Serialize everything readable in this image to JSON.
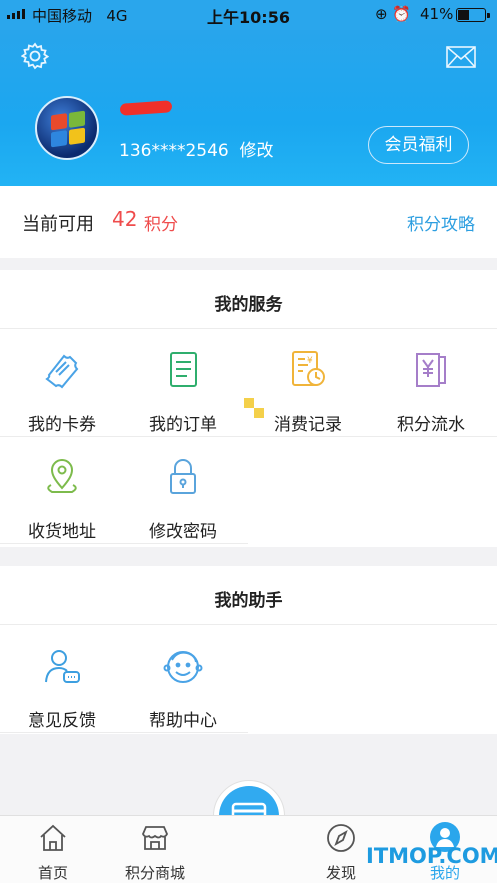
{
  "status_bar": {
    "carrier": "中国移动",
    "network": "4G",
    "time": "上午10:56",
    "battery_percent": "41%",
    "battery_level": 0.41
  },
  "header": {
    "settings_icon": "gear-icon",
    "message_icon": "envelope-icon",
    "avatar_icon": "windows-logo",
    "phone": "136****2546",
    "edit_label": "修改",
    "vip_button": "会员福利"
  },
  "points": {
    "label": "当前可用",
    "value": "42",
    "unit": "积分",
    "strategy_link": "积分攻略"
  },
  "services": {
    "title": "我的服务",
    "items": [
      {
        "label": "我的卡券",
        "icon": "ticket-icon"
      },
      {
        "label": "我的订单",
        "icon": "order-list-icon"
      },
      {
        "label": "消费记录",
        "icon": "receipt-clock-icon"
      },
      {
        "label": "积分流水",
        "icon": "yen-document-icon"
      },
      {
        "label": "收货地址",
        "icon": "location-pin-icon"
      },
      {
        "label": "修改密码",
        "icon": "padlock-icon"
      }
    ]
  },
  "helper": {
    "title": "我的助手",
    "items": [
      {
        "label": "意见反馈",
        "icon": "feedback-person-icon"
      },
      {
        "label": "帮助中心",
        "icon": "smiley-face-icon"
      }
    ]
  },
  "tabbar": {
    "items": [
      {
        "label": "首页",
        "icon": "home-icon"
      },
      {
        "label": "积分商城",
        "icon": "shop-icon"
      },
      {
        "label": "发现",
        "icon": "compass-icon"
      },
      {
        "label": "我的",
        "icon": "user-icon",
        "active": true
      }
    ],
    "center_icon": "card-payment-icon"
  },
  "watermark": "ITMOP.COM",
  "colors": {
    "brand_blue": "#2aa6ec",
    "points_red": "#ef4c4c",
    "link_blue": "#2c9ee0"
  }
}
